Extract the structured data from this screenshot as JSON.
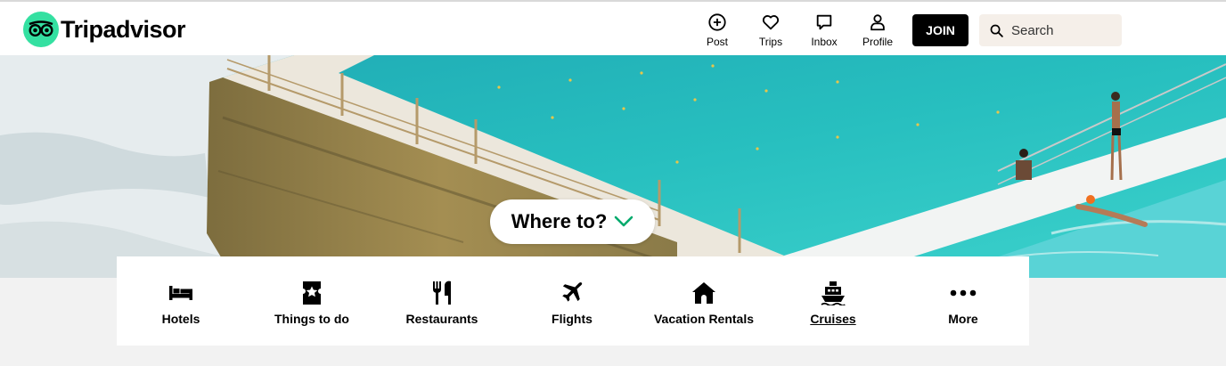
{
  "brand": {
    "name": "Tripadvisor",
    "logo_color": "#34e0a1"
  },
  "header": {
    "nav": [
      {
        "label": "Post",
        "icon": "plus-circle-icon"
      },
      {
        "label": "Trips",
        "icon": "heart-icon"
      },
      {
        "label": "Inbox",
        "icon": "chat-icon"
      },
      {
        "label": "Profile",
        "icon": "user-icon"
      }
    ],
    "join_label": "JOIN",
    "search_placeholder": "Search"
  },
  "hero": {
    "where_label": "Where to?",
    "accent_color": "#00aa6c"
  },
  "categories": [
    {
      "label": "Hotels",
      "icon": "bed-icon"
    },
    {
      "label": "Things to do",
      "icon": "ticket-icon"
    },
    {
      "label": "Restaurants",
      "icon": "fork-knife-icon"
    },
    {
      "label": "Flights",
      "icon": "plane-icon"
    },
    {
      "label": "Vacation Rentals",
      "icon": "house-icon"
    },
    {
      "label": "Cruises",
      "icon": "ship-icon",
      "underlined": true
    },
    {
      "label": "More",
      "icon": "more-dots-icon"
    }
  ]
}
